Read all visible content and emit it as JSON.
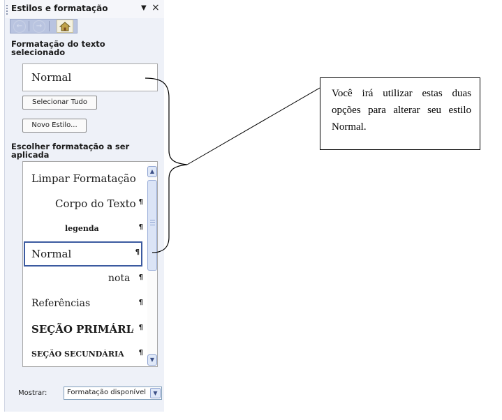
{
  "pane": {
    "title": "Estilos e formatação",
    "menu_arrow": "▼",
    "close": "×",
    "nav": {
      "back": "←",
      "forward": "→"
    },
    "section_current": "Formatação do texto selecionado",
    "current_style": "Normal",
    "select_all_label": "Selecionar Tudo",
    "new_style_label": "Novo Estilo...",
    "section_apply": "Escolher formatação a ser aplicada",
    "styles": [
      {
        "label": "Limpar Formatação",
        "mark": ""
      },
      {
        "label": "Corpo do Texto",
        "mark": "¶"
      },
      {
        "label": "legenda",
        "mark": "¶"
      },
      {
        "label": "Normal",
        "mark": "¶"
      },
      {
        "label": "nota",
        "mark": "¶"
      },
      {
        "label": "Referências",
        "mark": "¶"
      },
      {
        "label": "SEÇÃO PRIMÁRIA",
        "mark": "¶"
      },
      {
        "label": "SEÇÃO SECUNDÁRIA",
        "mark": "¶"
      }
    ],
    "selected_style": "Normal",
    "show_label": "Mostrar:",
    "show_value": "Formatação disponível"
  },
  "callout": {
    "text": "Você irá utilizar estas duas opções para alterar seu estilo Normal."
  }
}
